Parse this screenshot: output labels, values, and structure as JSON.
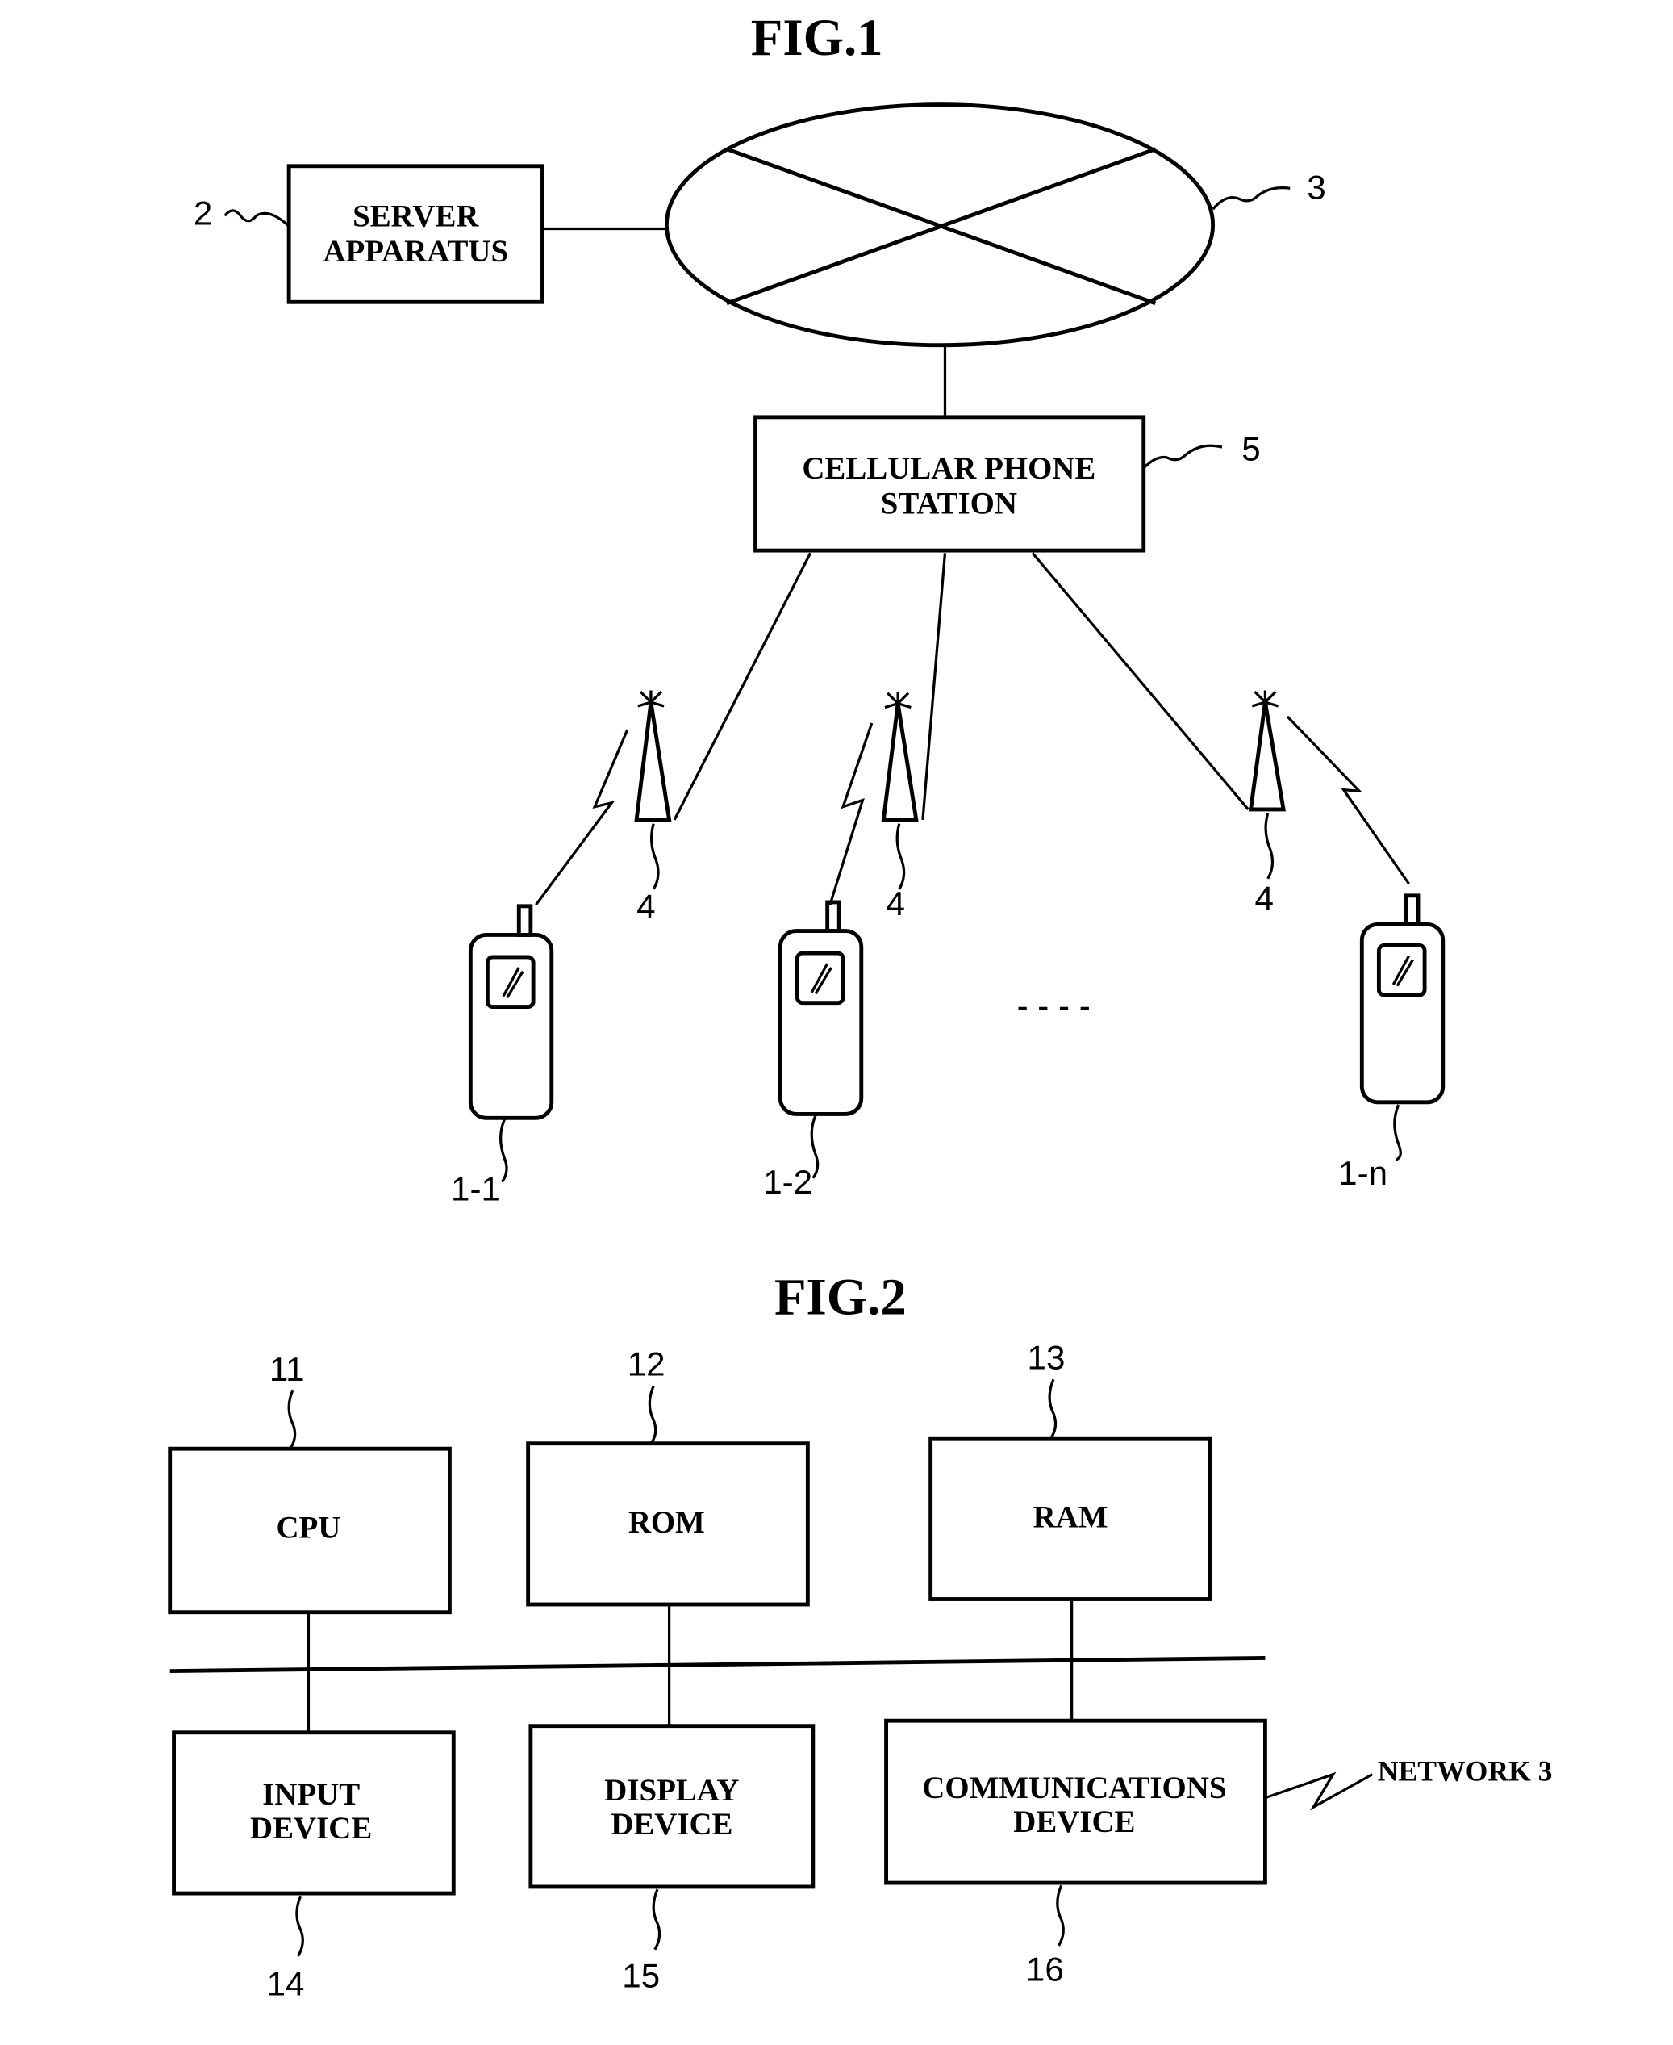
{
  "fig1": {
    "title": "FIG.1",
    "server": {
      "line1": "SERVER",
      "line2": "APPARATUS",
      "ref": "2"
    },
    "network": {
      "ref": "3"
    },
    "station": {
      "line1": "CELLULAR PHONE",
      "line2": "STATION",
      "ref": "5"
    },
    "base_station_ref": "4",
    "phones": [
      {
        "ref": "1-1"
      },
      {
        "ref": "1-2"
      },
      {
        "ref": "1-n"
      }
    ],
    "ellipsis": "- - - -"
  },
  "fig2": {
    "title": "FIG.2",
    "blocks": [
      {
        "label": "CPU",
        "ref": "11"
      },
      {
        "label": "ROM",
        "ref": "12"
      },
      {
        "label": "RAM",
        "ref": "13"
      },
      {
        "line1": "INPUT",
        "line2": "DEVICE",
        "ref": "14"
      },
      {
        "line1": "DISPLAY",
        "line2": "DEVICE",
        "ref": "15"
      },
      {
        "line1": "COMMUNICATIONS",
        "line2": "DEVICE",
        "ref": "16"
      }
    ],
    "network_label": "NETWORK 3"
  }
}
